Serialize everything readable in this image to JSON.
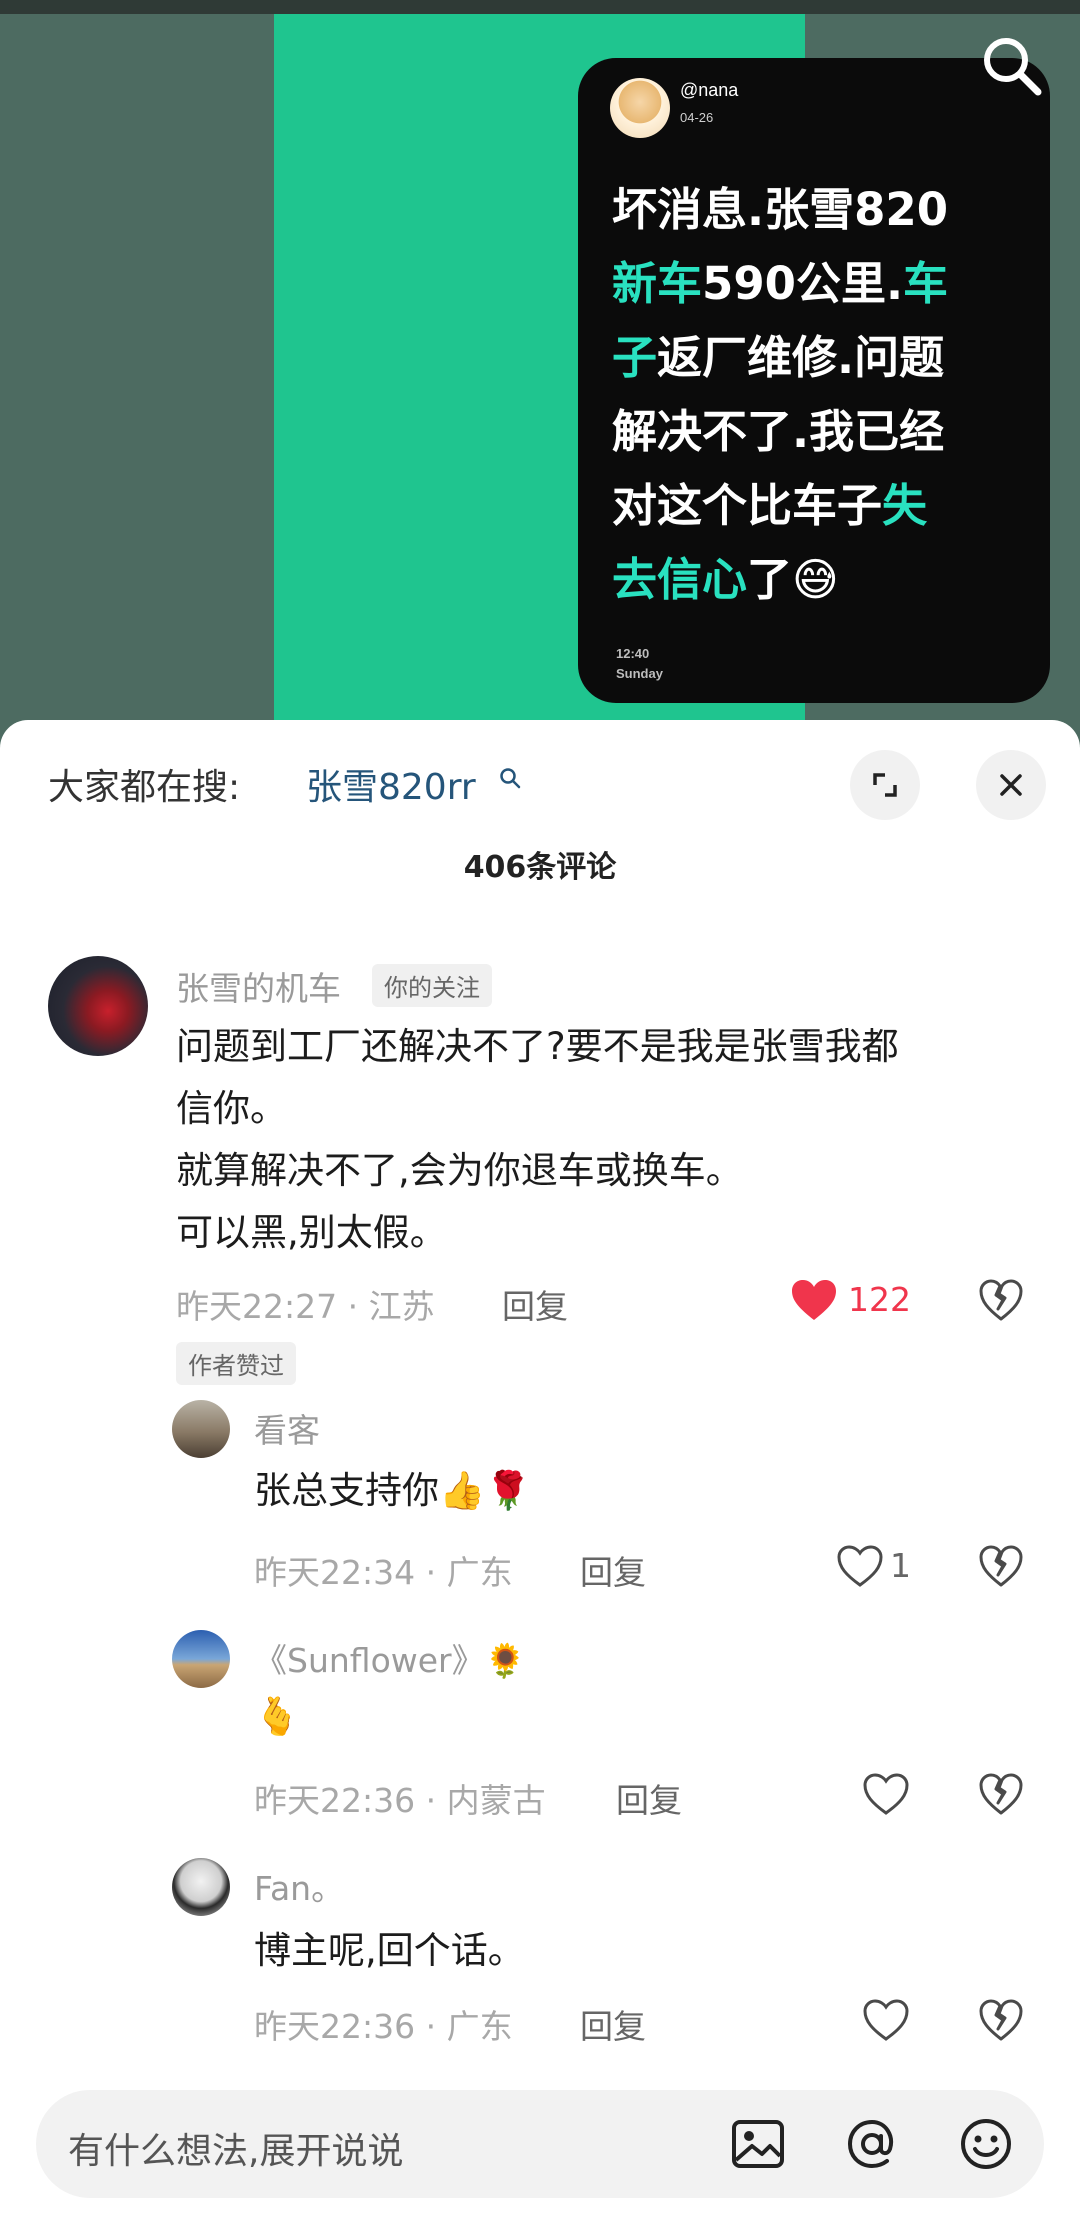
{
  "video": {
    "card": {
      "username": "@nana",
      "date": "04-26",
      "text_lines": [
        [
          {
            "t": "坏消息.张雪820",
            "hl": false
          }
        ],
        [
          {
            "t": "新车",
            "hl": true
          },
          {
            "t": "590公里.",
            "hl": false
          },
          {
            "t": "车",
            "hl": true
          }
        ],
        [
          {
            "t": "子",
            "hl": true
          },
          {
            "t": "返厂维修.问题",
            "hl": false
          }
        ],
        [
          {
            "t": "解决不了.我已经",
            "hl": false
          }
        ],
        [
          {
            "t": "对这个比车子",
            "hl": false
          },
          {
            "t": "失",
            "hl": true
          }
        ],
        [
          {
            "t": "去信心",
            "hl": true
          },
          {
            "t": "了😅",
            "hl": false
          }
        ]
      ],
      "time": "12:40",
      "day": "Sunday"
    },
    "search_icon": "search-icon"
  },
  "sheet": {
    "search_prefix": "大家都在搜:",
    "search_term": "张雪820rr",
    "comment_count": "406条评论"
  },
  "comments": [
    {
      "user": "张雪的机车",
      "tag": "你的关注",
      "lines": [
        "问题到工厂还解决不了?要不是我是张雪我都",
        "信你。",
        "就算解决不了,会为你退车或换车。",
        "可以黑,别太假。"
      ],
      "meta": "昨天22:27 · 江苏",
      "reply": "回复",
      "likes": "122",
      "liked": true,
      "author_liked": "作者赞过"
    },
    {
      "user": "看客",
      "text": "张总支持你👍🌹",
      "meta": "昨天22:34 · 广东",
      "reply": "回复",
      "likes": "1"
    },
    {
      "user": "《Sunflower》🌻",
      "text": "🫰",
      "meta": "昨天22:36 · 内蒙古",
      "reply": "回复",
      "likes": ""
    },
    {
      "user": "Fan。",
      "text": "博主呢,回个话。",
      "meta": "昨天22:36 · 广东",
      "reply": "回复",
      "likes": ""
    }
  ],
  "input": {
    "placeholder": "有什么想法,展开说说"
  },
  "colors": {
    "accent_highlight": "#29e1c0",
    "liked_heart": "#f0354c",
    "search_term": "#25557a",
    "frame_green": "#1fc58f"
  }
}
